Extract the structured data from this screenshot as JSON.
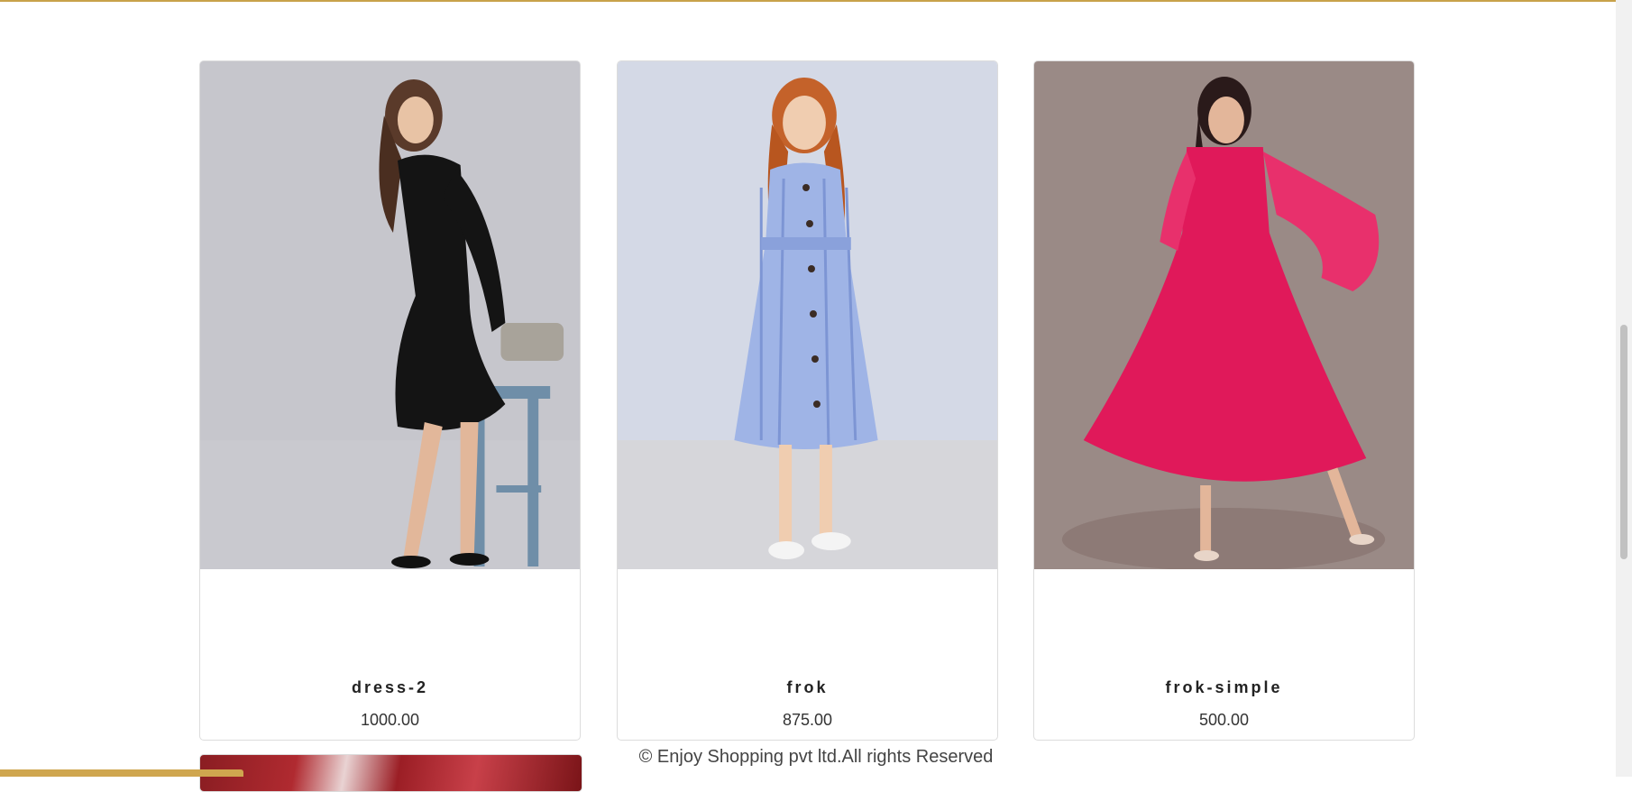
{
  "products": [
    {
      "name": "dress-2",
      "price": "1000.00"
    },
    {
      "name": "frok",
      "price": "875.00"
    },
    {
      "name": "frok-simple",
      "price": "500.00"
    }
  ],
  "footer": {
    "copyright": "© Enjoy Shopping pvt ltd.All rights Reserved"
  },
  "colors": {
    "accent": "#c8a24a",
    "card_border": "#dcdcdc"
  }
}
